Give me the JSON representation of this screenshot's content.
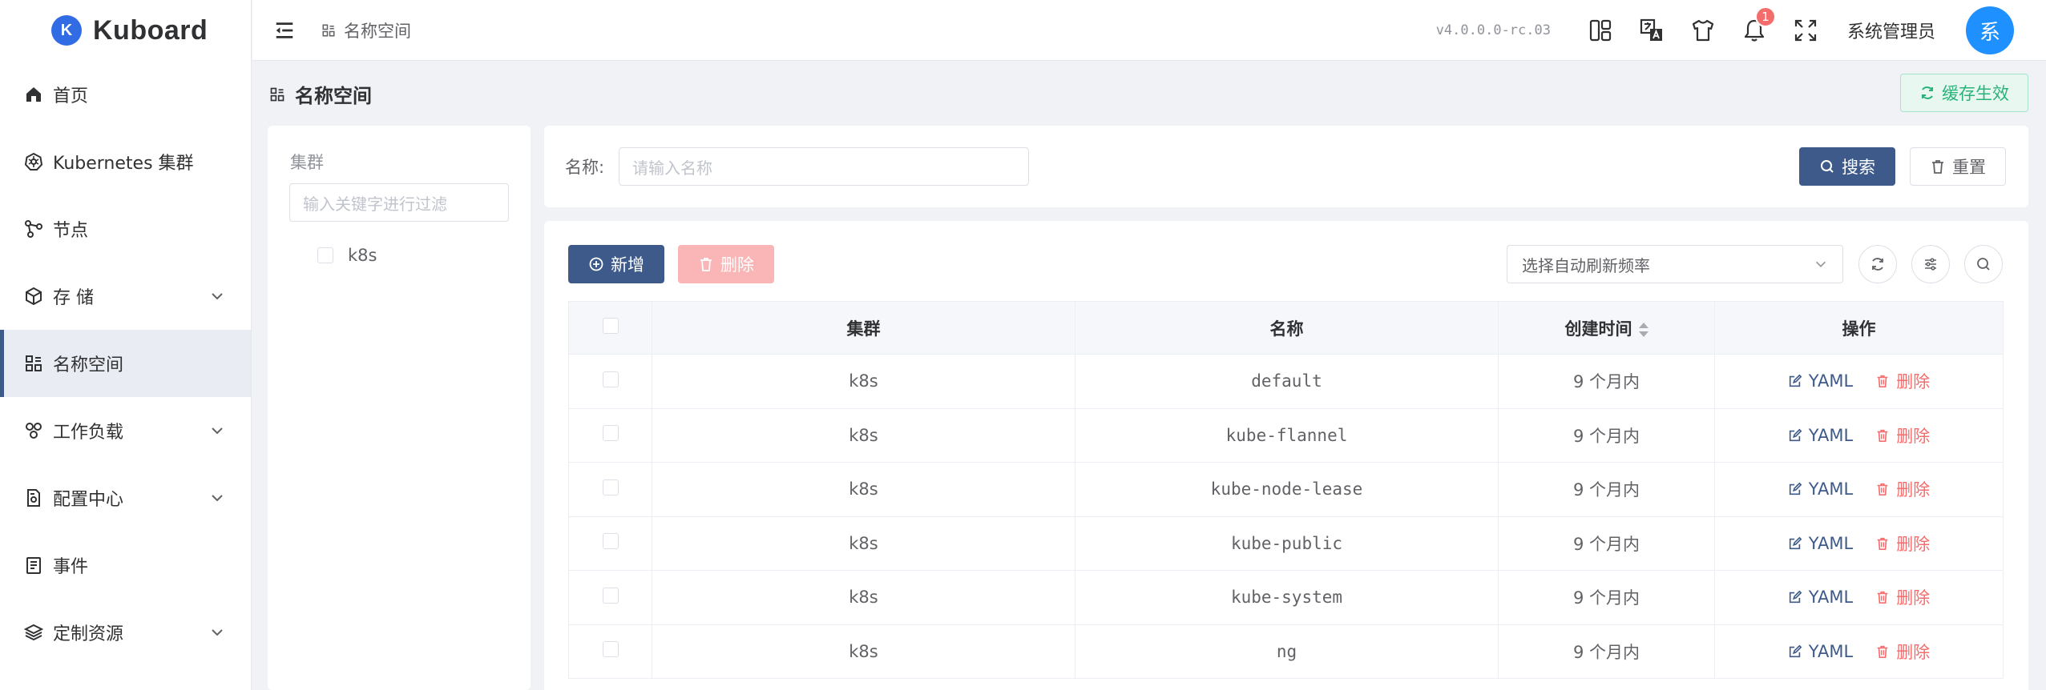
{
  "app": {
    "name": "Kuboard",
    "logo_letter": "K",
    "version": "v4.0.0.0-rc.03",
    "user": "系统管理员",
    "avatar_letter": "系",
    "notification_count": "1"
  },
  "breadcrumb": "名称空间",
  "sidebar": {
    "items": [
      {
        "label": "首页",
        "icon": "home-icon",
        "expandable": false
      },
      {
        "label": "Kubernetes 集群",
        "icon": "kubernetes-icon",
        "expandable": false
      },
      {
        "label": "节点",
        "icon": "nodes-icon",
        "expandable": false
      },
      {
        "label": "存 储",
        "icon": "storage-icon",
        "expandable": true
      },
      {
        "label": "名称空间",
        "icon": "namespace-icon",
        "expandable": false,
        "active": true
      },
      {
        "label": "工作负载",
        "icon": "workload-icon",
        "expandable": true
      },
      {
        "label": "配置中心",
        "icon": "config-icon",
        "expandable": true
      },
      {
        "label": "事件",
        "icon": "events-icon",
        "expandable": false
      },
      {
        "label": "定制资源",
        "icon": "layers-icon",
        "expandable": true
      }
    ]
  },
  "page": {
    "title": "名称空间",
    "cache_button": "缓存生效"
  },
  "cluster_panel": {
    "label": "集群",
    "filter_placeholder": "输入关键字进行过滤",
    "nodes": [
      "k8s"
    ]
  },
  "search": {
    "label": "名称:",
    "placeholder": "请输入名称",
    "search_button": "搜索",
    "reset_button": "重置"
  },
  "toolbar": {
    "add_button": "新增",
    "delete_button": "删除",
    "refresh_placeholder": "选择自动刷新频率"
  },
  "table": {
    "columns": [
      "集群",
      "名称",
      "创建时间",
      "操作"
    ],
    "rows": [
      {
        "cluster": "k8s",
        "name": "default",
        "created": "9 个月内"
      },
      {
        "cluster": "k8s",
        "name": "kube-flannel",
        "created": "9 个月内"
      },
      {
        "cluster": "k8s",
        "name": "kube-node-lease",
        "created": "9 个月内"
      },
      {
        "cluster": "k8s",
        "name": "kube-public",
        "created": "9 个月内"
      },
      {
        "cluster": "k8s",
        "name": "kube-system",
        "created": "9 个月内"
      },
      {
        "cluster": "k8s",
        "name": "ng",
        "created": "9 个月内"
      }
    ],
    "actions": {
      "yaml": "YAML",
      "delete": "删除"
    }
  },
  "colors": {
    "primary": "#3e5a8a",
    "danger": "#f56c6c",
    "success": "#29b379",
    "avatar": "#1e90ff"
  }
}
